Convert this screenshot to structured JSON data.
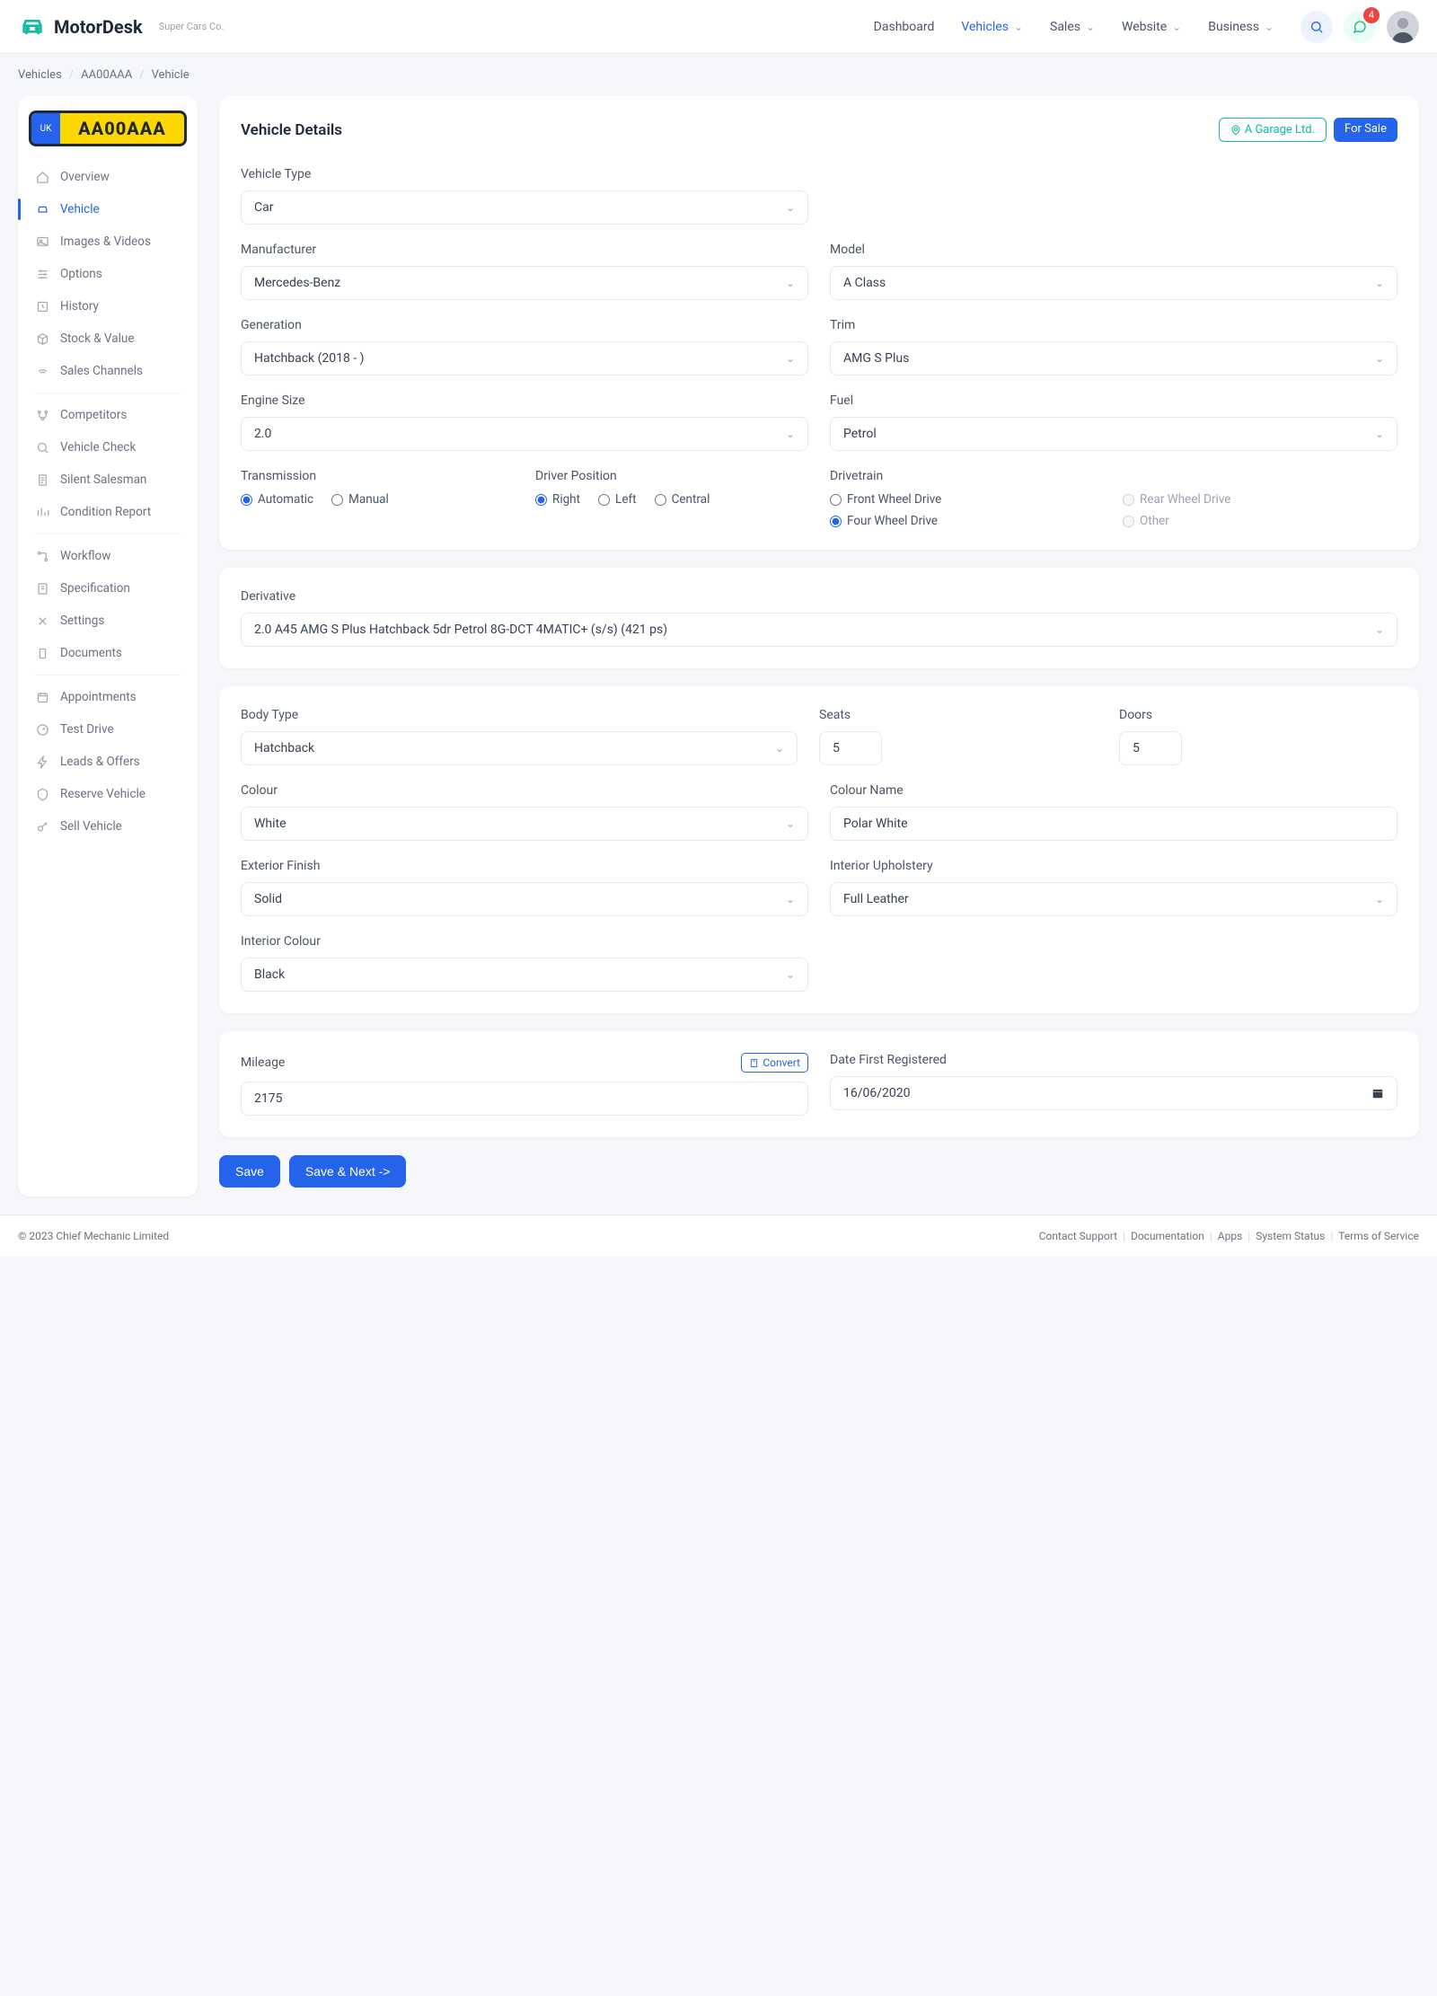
{
  "brand": {
    "name": "MotorDesk",
    "subtitle": "Super Cars Co."
  },
  "nav": [
    {
      "label": "Dashboard",
      "dropdown": false,
      "active": false
    },
    {
      "label": "Vehicles",
      "dropdown": true,
      "active": true
    },
    {
      "label": "Sales",
      "dropdown": true,
      "active": false
    },
    {
      "label": "Website",
      "dropdown": true,
      "active": false
    },
    {
      "label": "Business",
      "dropdown": true,
      "active": false
    }
  ],
  "notifications": {
    "count": "4"
  },
  "breadcrumb": [
    "Vehicles",
    "AA00AAA",
    "Vehicle"
  ],
  "plate": {
    "country": "UK",
    "reg": "AA00AAA"
  },
  "sidebar": [
    {
      "group": 0,
      "label": "Overview",
      "icon": "home"
    },
    {
      "group": 0,
      "label": "Vehicle",
      "icon": "car",
      "active": true
    },
    {
      "group": 0,
      "label": "Images & Videos",
      "icon": "image"
    },
    {
      "group": 0,
      "label": "Options",
      "icon": "sliders"
    },
    {
      "group": 0,
      "label": "History",
      "icon": "clock"
    },
    {
      "group": 0,
      "label": "Stock & Value",
      "icon": "box"
    },
    {
      "group": 0,
      "label": "Sales Channels",
      "icon": "signal"
    },
    {
      "group": 1,
      "label": "Competitors",
      "icon": "branch"
    },
    {
      "group": 1,
      "label": "Vehicle Check",
      "icon": "search"
    },
    {
      "group": 1,
      "label": "Silent Salesman",
      "icon": "doc"
    },
    {
      "group": 1,
      "label": "Condition Report",
      "icon": "report"
    },
    {
      "group": 2,
      "label": "Workflow",
      "icon": "flow"
    },
    {
      "group": 2,
      "label": "Specification",
      "icon": "spec"
    },
    {
      "group": 2,
      "label": "Settings",
      "icon": "tools"
    },
    {
      "group": 2,
      "label": "Documents",
      "icon": "file"
    },
    {
      "group": 3,
      "label": "Appointments",
      "icon": "cal"
    },
    {
      "group": 3,
      "label": "Test Drive",
      "icon": "gauge"
    },
    {
      "group": 3,
      "label": "Leads & Offers",
      "icon": "bolt"
    },
    {
      "group": 3,
      "label": "Reserve Vehicle",
      "icon": "shield"
    },
    {
      "group": 3,
      "label": "Sell Vehicle",
      "icon": "key"
    }
  ],
  "details": {
    "title": "Vehicle Details",
    "location_badge": "A Garage Ltd.",
    "status_badge": "For Sale",
    "labels": {
      "vehicle_type": "Vehicle Type",
      "manufacturer": "Manufacturer",
      "model": "Model",
      "generation": "Generation",
      "trim": "Trim",
      "engine_size": "Engine Size",
      "fuel": "Fuel",
      "transmission": "Transmission",
      "driver_position": "Driver Position",
      "drivetrain": "Drivetrain"
    },
    "values": {
      "vehicle_type": "Car",
      "manufacturer": "Mercedes-Benz",
      "model": "A Class",
      "generation": "Hatchback (2018 - )",
      "trim": "AMG S Plus",
      "engine_size": "2.0",
      "fuel": "Petrol"
    },
    "transmission": {
      "options": [
        "Automatic",
        "Manual"
      ],
      "selected": "Automatic"
    },
    "driver_position": {
      "options": [
        "Right",
        "Left",
        "Central"
      ],
      "selected": "Right"
    },
    "drivetrain": {
      "options": [
        "Front Wheel Drive",
        "Rear Wheel Drive",
        "Four Wheel Drive",
        "Other"
      ],
      "selected": "Four Wheel Drive",
      "disabled": [
        "Rear Wheel Drive",
        "Other"
      ]
    }
  },
  "derivative": {
    "label": "Derivative",
    "value": "2.0 A45 AMG S Plus Hatchback 5dr Petrol 8G-DCT 4MATIC+ (s/s) (421 ps)"
  },
  "body": {
    "labels": {
      "body_type": "Body Type",
      "seats": "Seats",
      "doors": "Doors",
      "colour": "Colour",
      "colour_name": "Colour Name",
      "exterior_finish": "Exterior Finish",
      "interior_upholstery": "Interior Upholstery",
      "interior_colour": "Interior Colour"
    },
    "values": {
      "body_type": "Hatchback",
      "seats": "5",
      "doors": "5",
      "colour": "White",
      "colour_name": "Polar White",
      "exterior_finish": "Solid",
      "interior_upholstery": "Full Leather",
      "interior_colour": "Black"
    }
  },
  "mileage_card": {
    "labels": {
      "mileage": "Mileage",
      "convert": "Convert",
      "date_first_registered": "Date First Registered"
    },
    "values": {
      "mileage": "2175",
      "date_first_registered": "16/06/2020"
    }
  },
  "buttons": {
    "save": "Save",
    "save_next": "Save & Next ->"
  },
  "footer": {
    "copyright": "© 2023 Chief Mechanic Limited",
    "links": [
      "Contact Support",
      "Documentation",
      "Apps",
      "System Status",
      "Terms of Service"
    ]
  }
}
